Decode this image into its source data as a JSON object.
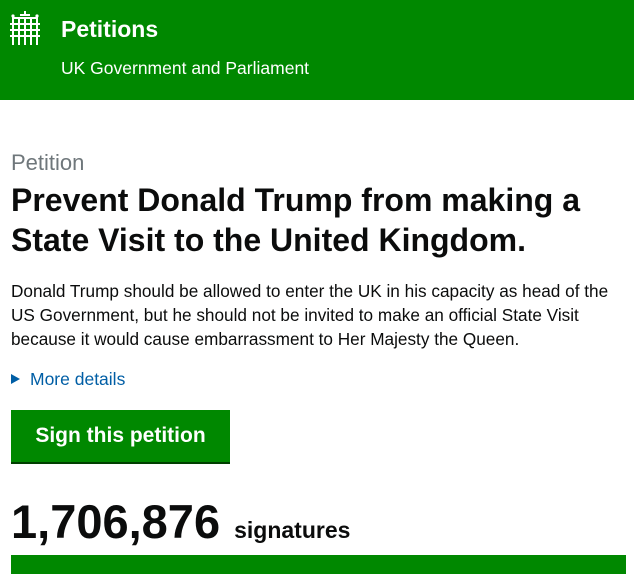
{
  "header": {
    "logo_icon": "portcullis-icon",
    "title": "Petitions",
    "subtitle": "UK Government and Parliament",
    "background_color": "#008800"
  },
  "petition": {
    "eyebrow": "Petition",
    "title": "Prevent Donald Trump from making a State Visit to the United Kingdom.",
    "description": "Donald Trump should be allowed to enter the UK in his capacity as head of the US Government, but he should not be invited to make an official State Visit because it would cause embarrassment to Her Majesty the Queen.",
    "more_details_label": "More details",
    "more_details_icon": "triangle-right-icon",
    "link_color": "#005ea5"
  },
  "sign_button": {
    "label": "Sign this petition",
    "color": "#008800"
  },
  "signatures": {
    "count": "1,706,876",
    "label": "signatures",
    "progress_fraction": 1.0
  }
}
